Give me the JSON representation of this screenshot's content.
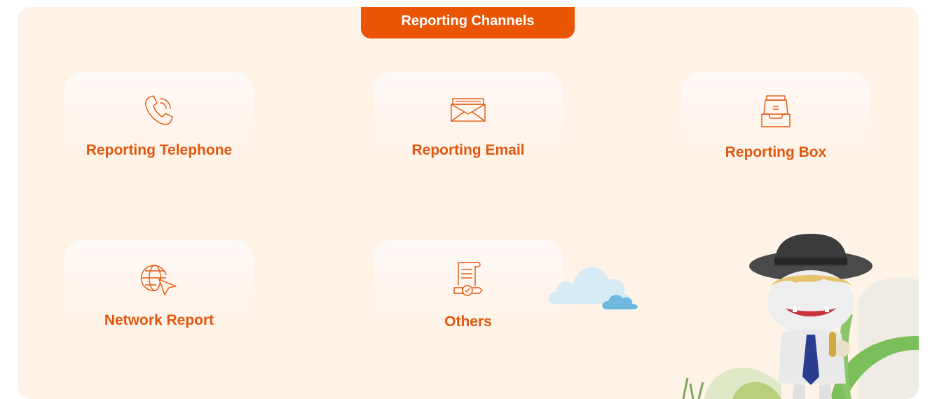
{
  "header": {
    "tab_label": "Reporting Channels"
  },
  "channels": [
    {
      "label": "Reporting Telephone",
      "icon": "phone-icon"
    },
    {
      "label": "Reporting Email",
      "icon": "email-icon"
    },
    {
      "label": "Reporting Box",
      "icon": "mailbox-icon"
    },
    {
      "label": "Network Report",
      "icon": "globe-cursor-icon"
    },
    {
      "label": "Others",
      "icon": "document-scroll-icon"
    }
  ],
  "colors": {
    "accent": "#ea5504",
    "panel_background": "#fff3e8",
    "label_text": "#e2570f"
  }
}
